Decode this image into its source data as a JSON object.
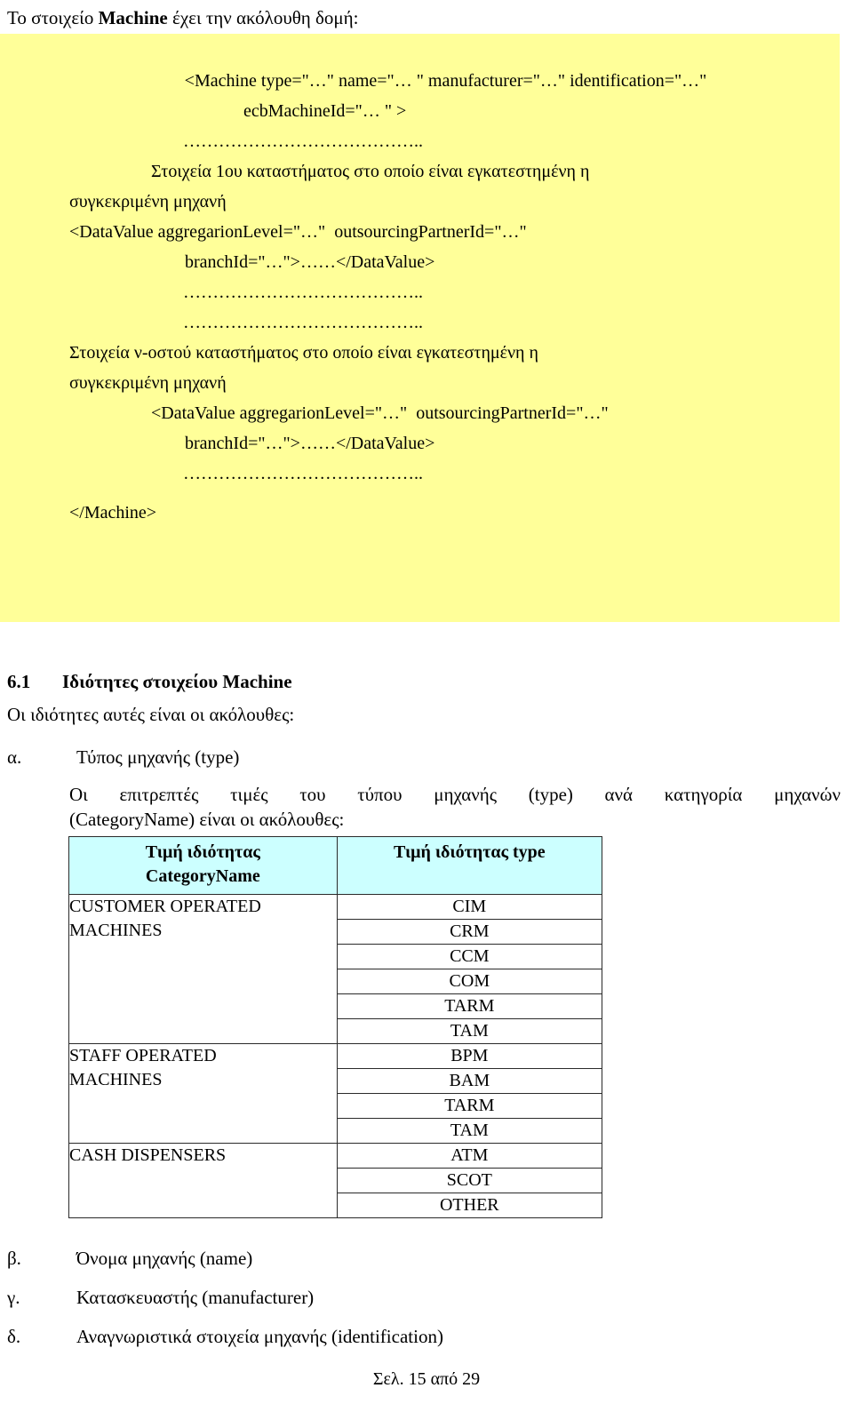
{
  "intro": {
    "before": "Το στοιχείο ",
    "bold": "Machine",
    "after": " έχει την ακόλουθη δομή:"
  },
  "code_block": {
    "background_color": "#ffff99",
    "lines": [
      "<Machine type=\"…\" name=\"… \" manufacturer=\"…\" identification=\"…\"",
      "ecbMachineId=\"… \" >",
      "…………………………………..",
      "Στοιχεία 1ου καταστήματος στο οποίο είναι εγκατεστημένη η",
      "συγκεκριμένη μηχανή",
      "<DataValue aggregarionLevel=\"…\"  outsourcingPartnerId=\"…\"",
      "branchId=\"…\">……</DataValue>",
      "…………………………………..",
      "…………………………………..",
      "Στοιχεία ν-οστού καταστήματος στο οποίο είναι εγκατεστημένη η",
      "συγκεκριμένη μηχανή",
      "<DataValue aggregarionLevel=\"…\"  outsourcingPartnerId=\"…\"",
      "branchId=\"…\">……</DataValue>",
      "…………………………………..",
      "</Machine>"
    ]
  },
  "section": {
    "number": "6.1",
    "title": "Ιδιότητες στοιχείου Machine",
    "lead_in": "Οι ιδιότητες αυτές είναι οι ακόλουθες:",
    "item_a_marker": "α.",
    "item_a_text": "Τύπος μηχανής (type)",
    "paragraph_line1": "Οι επιτρεπτές τιμές του τύπου μηχανής (type) ανά κατηγορία μηχανών",
    "paragraph_line2": "(CategoryName) είναι οι ακόλουθες:"
  },
  "table": {
    "header_color": "#ccffff",
    "headers": {
      "category": [
        "Τιμή ιδιότητας",
        "CategoryName"
      ],
      "type": "Τιμή ιδιότητας type"
    },
    "groups": [
      {
        "category_lines": [
          "CUSTOMER OPERATED",
          "MACHINES"
        ],
        "types": [
          "CIM",
          "CRM",
          "CCM",
          "COM",
          "TARM",
          "TAM"
        ]
      },
      {
        "category_lines": [
          "STAFF OPERATED",
          "MACHINES"
        ],
        "types": [
          "BPM",
          "BAM",
          "TARM",
          "TAM"
        ]
      },
      {
        "category_lines": [
          "CASH DISPENSERS"
        ],
        "types": [
          "ATM",
          "SCOT",
          "OTHER"
        ]
      }
    ]
  },
  "tail_items": [
    {
      "marker": "β.",
      "text": "Όνομα μηχανής (name)"
    },
    {
      "marker": "γ.",
      "text": "Κατασκευαστής (manufacturer)"
    },
    {
      "marker": "δ.",
      "text": "Αναγνωριστικά στοιχεία μηχανής (identification)"
    }
  ],
  "footer": "Σελ. 15 από 29"
}
